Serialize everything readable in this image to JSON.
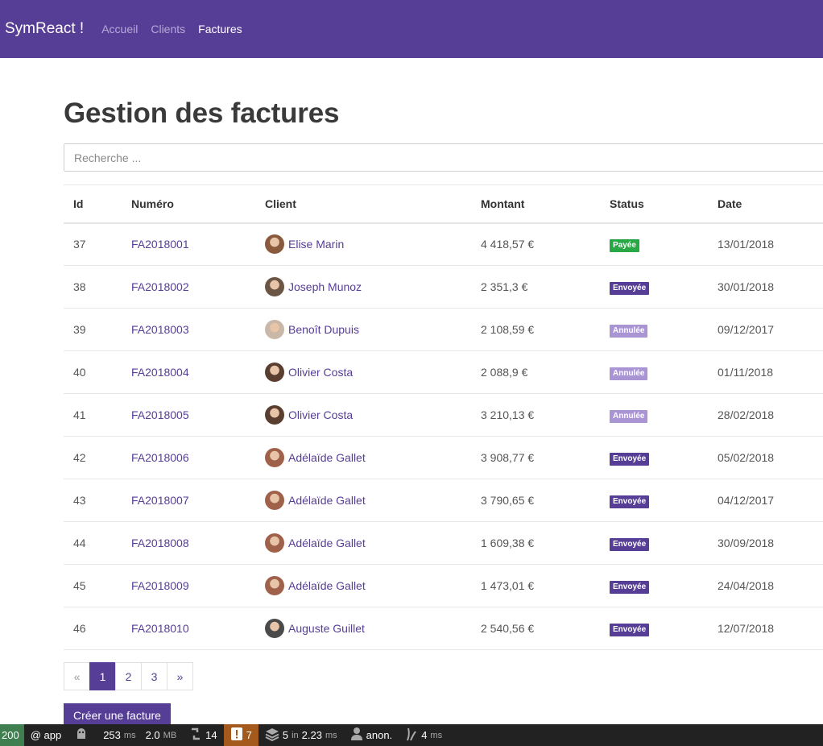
{
  "nav": {
    "brand": "SymReact !",
    "links": [
      {
        "label": "Accueil",
        "active": false
      },
      {
        "label": "Clients",
        "active": false
      },
      {
        "label": "Factures",
        "active": true
      }
    ]
  },
  "page": {
    "title": "Gestion des factures"
  },
  "search": {
    "placeholder": "Recherche ..."
  },
  "table": {
    "headers": {
      "id": "Id",
      "number": "Numéro",
      "client": "Client",
      "amount": "Montant",
      "status": "Status",
      "date": "Date"
    },
    "rows": [
      {
        "id": "37",
        "number": "FA2018001",
        "client": "Elise Marin",
        "amount": "4 418,57 €",
        "status": "Payée",
        "status_color": "#28a745",
        "date": "13/01/2018",
        "avatar_color": "#8a5a3c"
      },
      {
        "id": "38",
        "number": "FA2018002",
        "client": "Joseph Munoz",
        "amount": "2 351,3 €",
        "status": "Envoyée",
        "status_color": "#563d96",
        "date": "30/01/2018",
        "avatar_color": "#6b5545"
      },
      {
        "id": "39",
        "number": "FA2018003",
        "client": "Benoît Dupuis",
        "amount": "2 108,59 €",
        "status": "Annulée",
        "status_color": "#a995d3",
        "date": "09/12/2017",
        "avatar_color": "#c9b8a8"
      },
      {
        "id": "40",
        "number": "FA2018004",
        "client": "Olivier Costa",
        "amount": "2 088,9 €",
        "status": "Annulée",
        "status_color": "#a995d3",
        "date": "01/11/2018",
        "avatar_color": "#5a3e30"
      },
      {
        "id": "41",
        "number": "FA2018005",
        "client": "Olivier Costa",
        "amount": "3 210,13 €",
        "status": "Annulée",
        "status_color": "#a995d3",
        "date": "28/02/2018",
        "avatar_color": "#5a3e30"
      },
      {
        "id": "42",
        "number": "FA2018006",
        "client": "Adélaïde Gallet",
        "amount": "3 908,77 €",
        "status": "Envoyée",
        "status_color": "#563d96",
        "date": "05/02/2018",
        "avatar_color": "#a0614a"
      },
      {
        "id": "43",
        "number": "FA2018007",
        "client": "Adélaïde Gallet",
        "amount": "3 790,65 €",
        "status": "Envoyée",
        "status_color": "#563d96",
        "date": "04/12/2017",
        "avatar_color": "#a0614a"
      },
      {
        "id": "44",
        "number": "FA2018008",
        "client": "Adélaïde Gallet",
        "amount": "1 609,38 €",
        "status": "Envoyée",
        "status_color": "#563d96",
        "date": "30/09/2018",
        "avatar_color": "#a0614a"
      },
      {
        "id": "45",
        "number": "FA2018009",
        "client": "Adélaïde Gallet",
        "amount": "1 473,01 €",
        "status": "Envoyée",
        "status_color": "#563d96",
        "date": "24/04/2018",
        "avatar_color": "#a0614a"
      },
      {
        "id": "46",
        "number": "FA2018010",
        "client": "Auguste Guillet",
        "amount": "2 540,56 €",
        "status": "Envoyée",
        "status_color": "#563d96",
        "date": "12/07/2018",
        "avatar_color": "#4a4a4a"
      }
    ]
  },
  "pagination": {
    "prev": "«",
    "pages": [
      "1",
      "2",
      "3"
    ],
    "active": "1",
    "next": "»"
  },
  "create_button": {
    "label": "Créer une facture"
  },
  "debugbar": {
    "status_code": "200",
    "route": "@ app",
    "time_value": "253",
    "time_unit": "ms",
    "memory_value": "2.0",
    "memory_unit": "MB",
    "requests": "14",
    "warnings": "7",
    "cache_value": "5",
    "cache_in": "in",
    "cache_time": "2.23",
    "cache_unit": "ms",
    "user": "anon.",
    "twig_value": "4",
    "twig_unit": "ms"
  }
}
